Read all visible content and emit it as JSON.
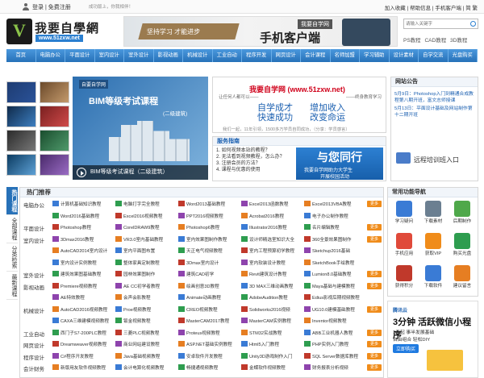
{
  "topbar": {
    "login": "登录",
    "register": "免费注册",
    "welcome": "成功版上，你我相伴！",
    "links": [
      "加入收藏",
      "帮助信息",
      "手机客户端",
      "简",
      "繁"
    ]
  },
  "logo": {
    "name": "我要自學網",
    "url": "www.51zxw.net"
  },
  "banner": {
    "road_text": "坚持学习 才能进步",
    "tag": "我要自学网",
    "big": "手机客户端"
  },
  "search": {
    "placeholder": "请输入关键字",
    "tags": [
      "PS教程",
      "CAD教程",
      "3D教程"
    ]
  },
  "nav": [
    "首页",
    "电脑办公",
    "平面设计",
    "室内设计",
    "室外设计",
    "影视动画",
    "机械设计",
    "工业自动",
    "程序开发",
    "网页设计",
    "会计课程",
    "名师加盟",
    "学习辅助",
    "设计素材",
    "自学交流",
    "光盘购买"
  ],
  "hero": {
    "badge": "自要自学网",
    "title": "BIM等级考试课程",
    "subtitle": "(二级建筑)",
    "caption": "BIM等级考试课程（二级建筑）"
  },
  "slogan": {
    "title": "我要自学网 (www.51zxw.net)",
    "left": "让任何人都可以——",
    "right": "——终身教育学习",
    "big1": "自学成才",
    "big2": "快速成功",
    "big3": "增加收入",
    "big4": "改变命运",
    "stat": "我们一起，11年引领，1500多万学员自同成功，（分享：学员感言）"
  },
  "guide": {
    "title": "服务指南",
    "items": [
      "1. 如何视频本站的教程？",
      "2. 无法看到视频教程，怎么办？",
      "3. 注册会员的方法？",
      "4. 课程与优惠的使用"
    ],
    "promo1": "与您同行",
    "promo2": "我要自学网助力大学生",
    "promo3": "开展校园活动"
  },
  "notice": {
    "title": "网站公告",
    "items": [
      "5月9日：Photoshop入门到精通合成教程第八期开班，富文志师授课",
      "5月13日：平面设计基础及网站制作第十二期开班"
    ],
    "train": "远程培训班入口"
  },
  "sidetabs": [
    {
      "label": "热门课程",
      "active": true
    },
    {
      "label": "全部课程",
      "active": false
    },
    {
      "label": "分类检索",
      "active": false
    },
    {
      "label": "最新课程",
      "active": false
    }
  ],
  "hot": {
    "title": "热门推荐",
    "more": "更多"
  },
  "categories": [
    "电脑办公",
    "平面设计",
    "室内设计",
    "室外设计",
    "影视动画",
    "机械设计",
    "工业自动",
    "网页设计",
    "程序设计",
    "会计财务"
  ],
  "courses": [
    [
      "计算机基础知识教程",
      "电脑打字完全教程",
      "Word2013基础教程",
      "Excel2013函数教程",
      "Excel2013VBA教程"
    ],
    [
      "Word2016基础教程",
      "Excel2016视频教程",
      "PPT2016视频教程",
      "Acrobat2016教程",
      "电子办公制作教程"
    ],
    [
      "Photoshop教程",
      "CorelDRAW9教程",
      "Photoshop6教程",
      "Illustrator2016教程",
      "名片编辑教程"
    ],
    [
      "3Dmax2016教程",
      "VR3.0室内基础教程",
      "室内效果图制作教程",
      "设计师精选室知识大全",
      "360全景效果图制作"
    ],
    [
      "AutoCAD2014室内设计",
      "室内平面图布置",
      "天正电气视频教程",
      "室内工程预算初学教程",
      "Sketchup2016基础"
    ],
    [
      "室内设计实例教程",
      "整体家具定制教程",
      "3Dmax室内设计",
      "室内软装设计教程",
      "SketchBook手绘教程"
    ],
    [
      "建筑效果图基础教程",
      "园林效果图制作",
      "建筑CAD初学",
      "Revit建筑设计教程",
      "Lumion8.0基础教程"
    ],
    [
      "Premiere视频教程",
      "AE CC初学者教程",
      "绘画创意3D教程",
      "3D MAX三维动画教程",
      "Maya基础与建模教程"
    ],
    [
      "AE特效教程",
      "会声会影教程",
      "Animate动画教程",
      "AdobeAudition教程",
      "Edius影视后期视频教程"
    ],
    [
      "AutoCAD2016视频教程",
      "Proe视频教程",
      "CREO视频教程",
      "Solidworks2016视频",
      "UG10.0建模基础教程"
    ],
    [
      "CAXA三维建模视频教程",
      "钣金视频教程",
      "MasterCAM2017教程",
      "MasterCAM实例教程",
      "Inventor视频教程"
    ],
    [
      "西门子S7-200PLC教程",
      "三菱PLC视频教程",
      "Proteus视频教程",
      "STM32实战教程",
      "ABB工业机器人教程"
    ],
    [
      "Dreamweaver视频教程",
      "商业网站建设教程",
      "ASP.NET基础实例教程",
      "Html5入门教程",
      "PHP实例入门教程"
    ],
    [
      "C#程序开发教程",
      "Java基础视频教程",
      "安卓软件开发教程",
      "Unity3D游戏制作入门",
      "SQL Server数据库教程"
    ],
    [
      "新版用友软件视频教程",
      "会计电算化视频教程",
      "畅捷通视频教程",
      "金蝶软件视频教程",
      "财务报表分析视频"
    ]
  ],
  "tools": {
    "title": "常用功能导航",
    "items": [
      "学习疑问",
      "下载素材",
      "后期制作",
      "手机应用",
      "获取VIP",
      "购买光盘",
      "获得积分",
      "下载软件",
      "建议留言"
    ]
  },
  "ad": {
    "brand": "腾讯云",
    "headline": "3分钟 活跃微信小程序",
    "line1": "1元起 事半发展基础",
    "line2": "自由组合 轻松DIY",
    "btn": "立即购买"
  },
  "colors": {
    "nav": "#2771b8",
    "accent": "#d0021b",
    "orange": "#f08c1a"
  }
}
